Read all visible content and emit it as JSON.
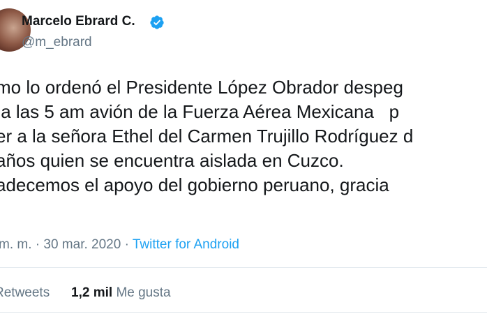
{
  "author": {
    "display_name": "Marcelo Ebrard C.",
    "handle": "@m_ebrard",
    "verified_icon": "verified-badge-icon"
  },
  "tweet": {
    "lines": [
      "mo lo ordenó el Presidente López Obrador despeg",
      " a las 5 am avión de la Fuerza Aérea Mexicana   p",
      "er a la señora Ethel del Carmen Trujillo Rodríguez d",
      "años quien se encuentra aislada en Cuzco.",
      "adecemos el apoyo del gobierno peruano, gracia"
    ]
  },
  "meta": {
    "time": "m. m.",
    "separator": "·",
    "date": "30 mar. 2020",
    "source": "Twitter for Android"
  },
  "stats": {
    "retweets_label": "Retweets",
    "likes_count": "1,2 mil",
    "likes_label": "Me gusta"
  },
  "colors": {
    "accent": "#1da1f2",
    "text": "#14171a",
    "secondary": "#657786"
  }
}
